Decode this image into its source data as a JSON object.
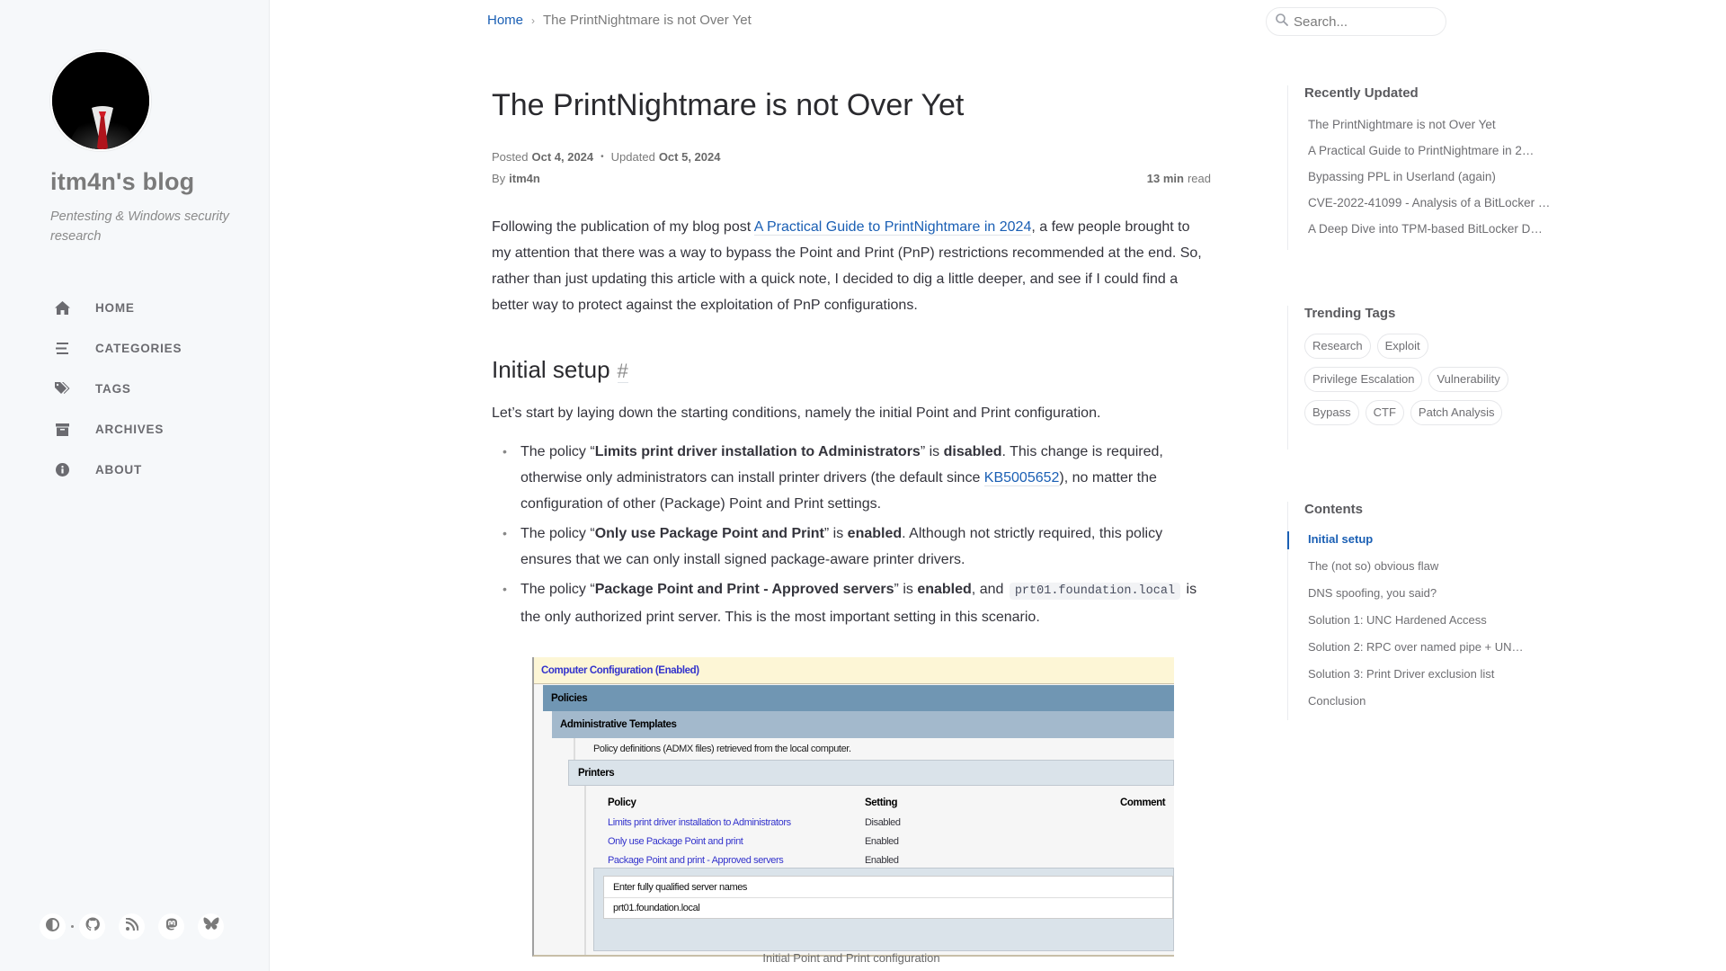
{
  "sidebar": {
    "site_title": "itm4n's blog",
    "site_subtitle": "Pentesting & Windows security research",
    "nav": [
      {
        "label": "HOME",
        "icon": "home-icon"
      },
      {
        "label": "CATEGORIES",
        "icon": "bars-icon"
      },
      {
        "label": "TAGS",
        "icon": "tags-icon"
      },
      {
        "label": "ARCHIVES",
        "icon": "archive-icon"
      },
      {
        "label": "ABOUT",
        "icon": "info-icon"
      }
    ],
    "bottom_icons": [
      "theme-toggle-icon",
      "github-icon",
      "rss-icon",
      "mastodon-icon",
      "bluesky-icon"
    ]
  },
  "topbar": {
    "breadcrumb_home": "Home",
    "breadcrumb_sep": "›",
    "breadcrumb_current": "The PrintNightmare is not Over Yet",
    "search_placeholder": "Search..."
  },
  "post": {
    "title": "The PrintNightmare is not Over Yet",
    "posted_label": "Posted",
    "posted_date": "Oct 4, 2024",
    "updated_label": "Updated",
    "updated_date": "Oct 5, 2024",
    "by_label": "By",
    "author": "itm4n",
    "read_time_value": "13 min",
    "read_time_suffix": "read",
    "intro_before_link": "Following the publication of my blog post ",
    "intro_link": "A Practical Guide to PrintNightmare in 2024",
    "intro_after_link": ", a few people brought to my attention that there was a way to bypass the Point and Print (PnP) restrictions recommended at the end. So, rather than just updating this article with a quick note, I decided to dig a little deeper, and see if I could find a better way to protect against the exploitation of PnP configurations.",
    "section_heading": "Initial setup",
    "section_anchor": "#",
    "section_intro": "Let’s start by laying down the starting conditions, namely the initial Point and Print configuration.",
    "bullets": [
      {
        "pre": "The policy “",
        "policy": "Limits print driver installation to Administrators",
        "mid": "” is ",
        "state": "disabled",
        "post_before_link": ". This change is required, otherwise only administrators can install printer drivers (the default since ",
        "link": "KB5005652",
        "post_after_link": "), no matter the configuration of other (Package) Point and Print settings."
      },
      {
        "pre": "The policy “",
        "policy": "Only use Package Point and Print",
        "mid": "” is ",
        "state": "enabled",
        "post": ". Although not strictly required, this policy ensures that we can only install signed package-aware printer drivers."
      },
      {
        "pre": "The policy “",
        "policy": "Package Point and Print - Approved servers",
        "mid": "” is ",
        "state": "enabled",
        "post_before_code": ", and ",
        "code": "prt01.foundation.local",
        "post_after_code": " is the only authorized print server. This is the most important setting in this scenario."
      }
    ],
    "figure": {
      "computer_config": "Computer Configuration (Enabled)",
      "policies": "Policies",
      "admin_templates": "Administrative Templates",
      "definitions_note": "Policy definitions (ADMX files) retrieved from the local computer.",
      "printers": "Printers",
      "columns": [
        "Policy",
        "Setting",
        "Comment"
      ],
      "rows": [
        {
          "policy": "Limits print driver installation to Administrators",
          "setting": "Disabled"
        },
        {
          "policy": "Only use Package Point and print",
          "setting": "Enabled"
        },
        {
          "policy": "Package Point and print - Approved servers",
          "setting": "Enabled"
        }
      ],
      "server_label": "Enter fully qualified server names",
      "server_value": "prt01.foundation.local",
      "caption": "Initial Point and Print configuration"
    }
  },
  "panel": {
    "recent_heading": "Recently Updated",
    "recent": [
      "The PrintNightmare is not Over Yet",
      "A Practical Guide to PrintNightmare in 2…",
      "Bypassing PPL in Userland (again)",
      "CVE-2022-41099 - Analysis of a BitLocker …",
      "A Deep Dive into TPM-based BitLocker D…"
    ],
    "tags_heading": "Trending Tags",
    "tags": [
      "Research",
      "Exploit",
      "Privilege Escalation",
      "Vulnerability",
      "Bypass",
      "CTF",
      "Patch Analysis"
    ],
    "toc_heading": "Contents",
    "toc": [
      {
        "label": "Initial setup",
        "active": true
      },
      {
        "label": "The (not so) obvious flaw",
        "active": false
      },
      {
        "label": "DNS spoofing, you said?",
        "active": false
      },
      {
        "label": "Solution 1: UNC Hardened Access",
        "active": false
      },
      {
        "label": "Solution 2: RPC over named pipe + UN…",
        "active": false
      },
      {
        "label": "Solution 3: Print Driver exclusion list",
        "active": false
      },
      {
        "label": "Conclusion",
        "active": false
      }
    ]
  },
  "colors": {
    "accent": "#1a5fb4",
    "sidebar_bg": "#f6f8fa",
    "gpo_link": "#3333cc"
  }
}
